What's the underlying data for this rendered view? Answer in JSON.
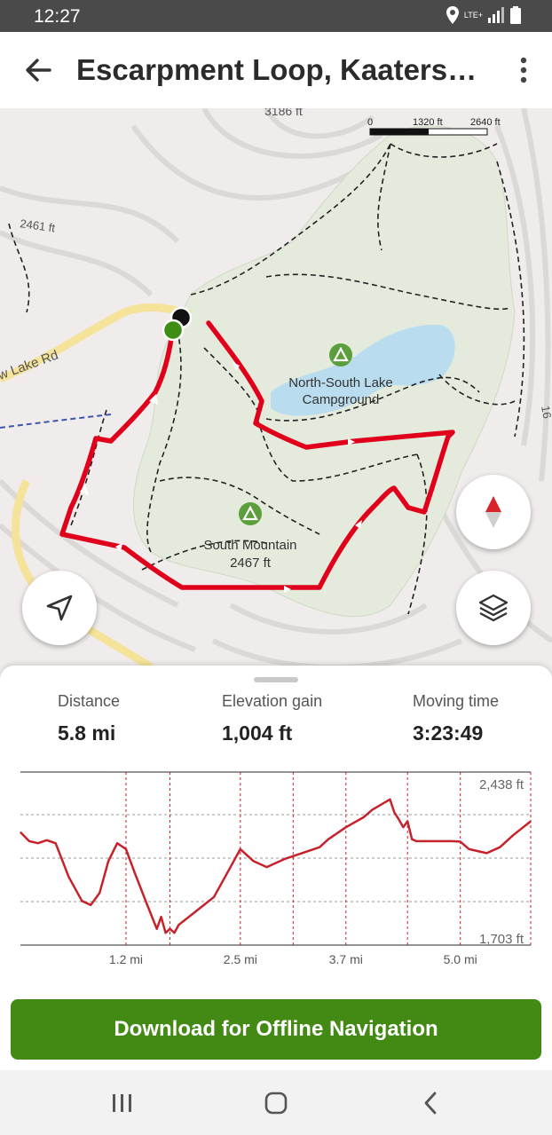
{
  "status_bar": {
    "time": "12:27",
    "network": "LTE+"
  },
  "app_bar": {
    "title": "Escarpment Loop, Kaaters…",
    "back_icon": "arrow-left-icon",
    "menu_icon": "more-vertical-icon"
  },
  "map": {
    "scale": {
      "zero": "0",
      "mid": "1320 ft",
      "max": "2640 ft"
    },
    "labels": {
      "contour_top": "3186 ft",
      "contour_left": "2461 ft",
      "road": "w Lake Rd",
      "edge_label": "16",
      "campground_line1": "North-South Lake",
      "campground_line2": "Campground",
      "mountain_line1": "South Mountain",
      "mountain_line2": "2467 ft"
    },
    "colors": {
      "route": "#e0001b",
      "park": "#e4ebdc",
      "water": "#b9dcef",
      "poi": "#5a9f3c",
      "start": "#3e8d14"
    }
  },
  "buttons": {
    "compass_icon": "compass-icon",
    "locate_icon": "locate-arrow-icon",
    "layers_icon": "layers-icon"
  },
  "stats": [
    {
      "label": "Distance",
      "value": "5.8 mi"
    },
    {
      "label": "Elevation gain",
      "value": "1,004 ft"
    },
    {
      "label": "Moving time",
      "value": "3:23:49"
    }
  ],
  "chart_data": {
    "type": "line",
    "x_unit": "mi",
    "y_unit": "ft",
    "ylim": [
      1703,
      2438
    ],
    "y_tick_labels": [
      "2,438 ft",
      "1,703 ft"
    ],
    "x_tick_labels": [
      {
        "x": 1.2,
        "label": "1.2 mi"
      },
      {
        "x": 2.5,
        "label": "2.5 mi"
      },
      {
        "x": 3.7,
        "label": "3.7 mi"
      },
      {
        "x": 5.0,
        "label": "5.0 mi"
      }
    ],
    "xlim": [
      0,
      5.8
    ],
    "grid": true,
    "color": "#c6222b",
    "series": [
      {
        "values": [
          [
            0.0,
            2225
          ],
          [
            0.1,
            2180
          ],
          [
            0.2,
            2170
          ],
          [
            0.3,
            2185
          ],
          [
            0.4,
            2170
          ],
          [
            0.55,
            2000
          ],
          [
            0.7,
            1880
          ],
          [
            0.8,
            1860
          ],
          [
            0.9,
            1920
          ],
          [
            1.0,
            2080
          ],
          [
            1.1,
            2170
          ],
          [
            1.2,
            2140
          ],
          [
            1.3,
            2020
          ],
          [
            1.45,
            1850
          ],
          [
            1.55,
            1740
          ],
          [
            1.6,
            1800
          ],
          [
            1.65,
            1720
          ],
          [
            1.7,
            1740
          ],
          [
            1.75,
            1720
          ],
          [
            1.8,
            1760
          ],
          [
            2.0,
            1830
          ],
          [
            2.2,
            1900
          ],
          [
            2.35,
            2020
          ],
          [
            2.5,
            2140
          ],
          [
            2.65,
            2080
          ],
          [
            2.8,
            2050
          ],
          [
            3.0,
            2090
          ],
          [
            3.2,
            2120
          ],
          [
            3.4,
            2150
          ],
          [
            3.5,
            2190
          ],
          [
            3.7,
            2250
          ],
          [
            3.9,
            2300
          ],
          [
            4.0,
            2338
          ],
          [
            4.2,
            2390
          ],
          [
            4.25,
            2325
          ],
          [
            4.3,
            2290
          ],
          [
            4.35,
            2250
          ],
          [
            4.4,
            2280
          ],
          [
            4.45,
            2190
          ],
          [
            4.5,
            2180
          ],
          [
            4.7,
            2180
          ],
          [
            4.9,
            2180
          ],
          [
            5.0,
            2178
          ],
          [
            5.1,
            2140
          ],
          [
            5.3,
            2120
          ],
          [
            5.45,
            2150
          ],
          [
            5.6,
            2210
          ],
          [
            5.8,
            2280
          ]
        ]
      }
    ]
  },
  "cta": {
    "label": "Download for Offline Navigation"
  },
  "nav": {
    "recent_icon": "recent-apps-icon",
    "home_icon": "home-icon",
    "back_icon": "back-nav-icon"
  }
}
